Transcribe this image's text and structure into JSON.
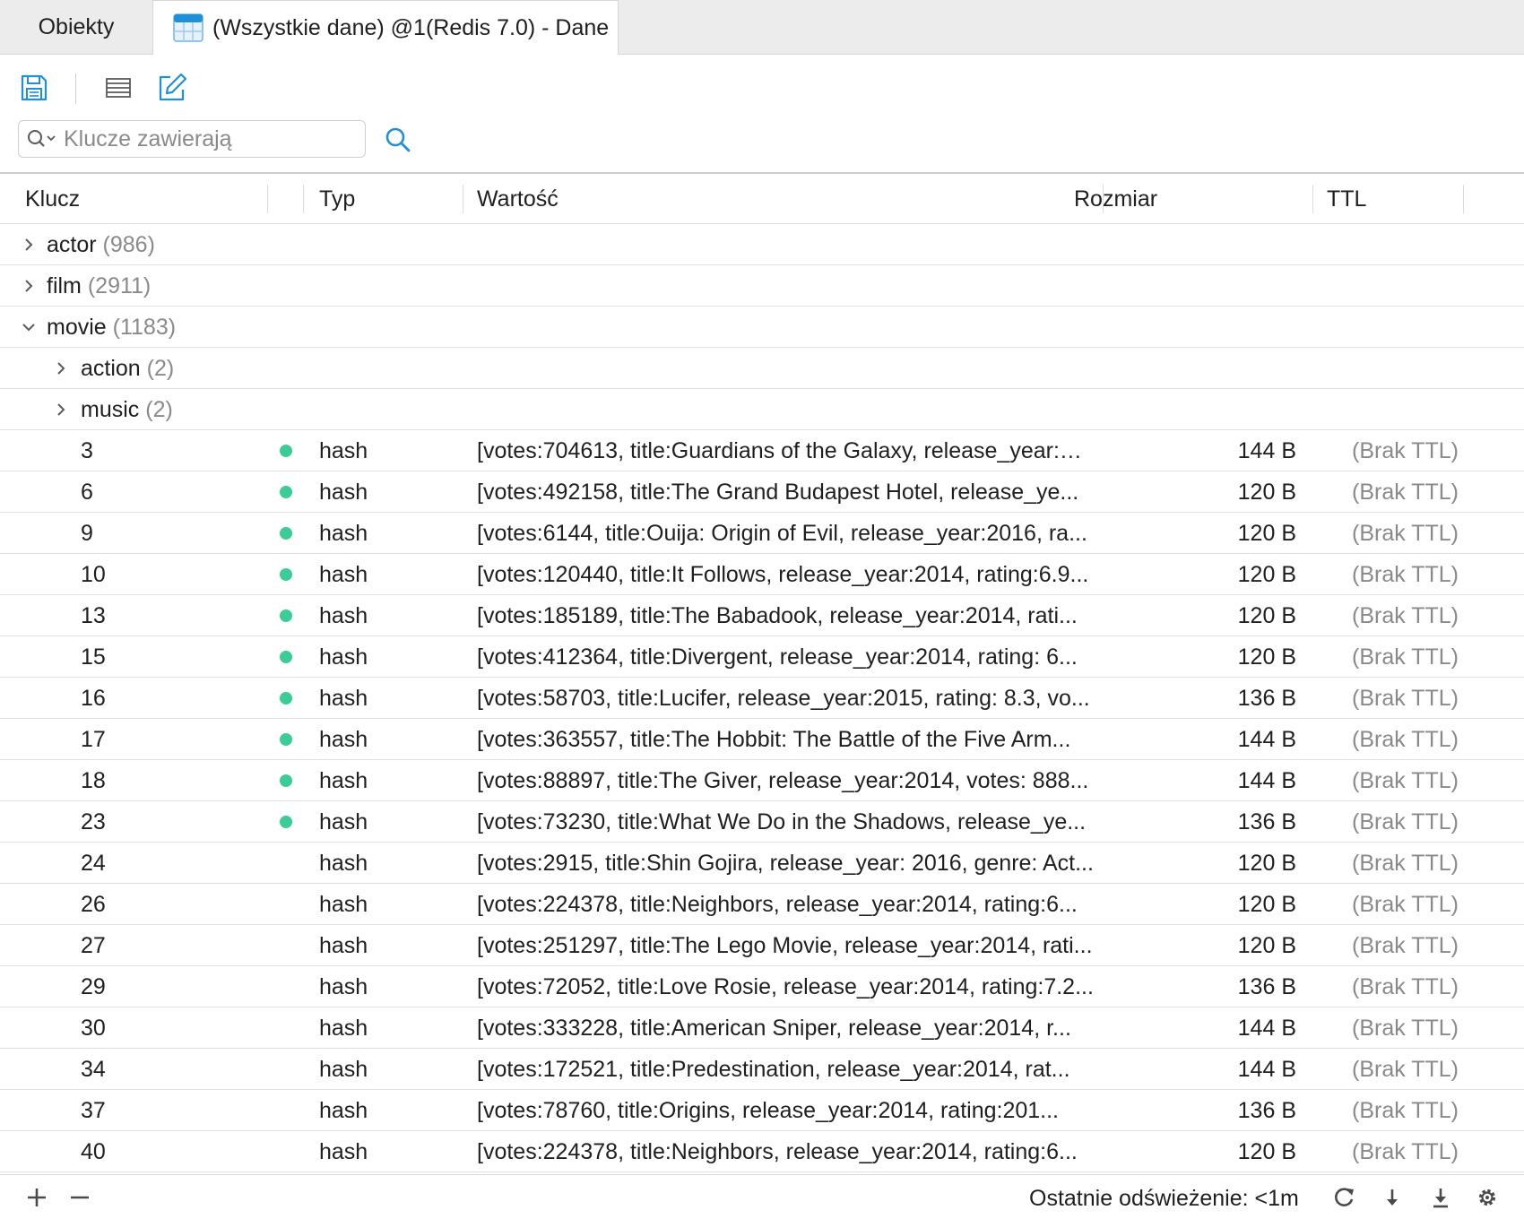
{
  "tabs": {
    "objects_label": "Obiekty",
    "active_label": "(Wszystkie dane) @1(Redis 7.0) - Dane"
  },
  "search": {
    "placeholder": "Klucze zawierają"
  },
  "columns": {
    "key": "Klucz",
    "type": "Typ",
    "value": "Wartość",
    "size": "Rozmiar",
    "ttl": "TTL"
  },
  "groups": [
    {
      "name": "actor",
      "count": "(986)",
      "expanded": false,
      "level": 0
    },
    {
      "name": "film",
      "count": "(2911)",
      "expanded": false,
      "level": 0
    },
    {
      "name": "movie",
      "count": "(1183)",
      "expanded": true,
      "level": 0
    },
    {
      "name": "action",
      "count": "(2)",
      "expanded": false,
      "level": 1
    },
    {
      "name": "music",
      "count": "(2)",
      "expanded": false,
      "level": 1
    }
  ],
  "records": [
    {
      "key": "3",
      "loaded": true,
      "type": "hash",
      "value": "[votes:704613, title:Guardians of the Galaxy, release_year:…",
      "size": "144 B",
      "ttl": "(Brak TTL)"
    },
    {
      "key": "6",
      "loaded": true,
      "type": "hash",
      "value": "[votes:492158, title:The Grand Budapest Hotel, release_ye...",
      "size": "120 B",
      "ttl": "(Brak TTL)"
    },
    {
      "key": "9",
      "loaded": true,
      "type": "hash",
      "value": "[votes:6144, title:Ouija: Origin of Evil, release_year:2016, ra...",
      "size": "120 B",
      "ttl": "(Brak TTL)"
    },
    {
      "key": "10",
      "loaded": true,
      "type": "hash",
      "value": "[votes:120440, title:It Follows, release_year:2014, rating:6.9...",
      "size": "120 B",
      "ttl": "(Brak TTL)"
    },
    {
      "key": "13",
      "loaded": true,
      "type": "hash",
      "value": "[votes:185189, title:The Babadook, release_year:2014, rati...",
      "size": "120 B",
      "ttl": "(Brak TTL)"
    },
    {
      "key": "15",
      "loaded": true,
      "type": "hash",
      "value": "[votes:412364, title:Divergent, release_year:2014, rating: 6...",
      "size": "120 B",
      "ttl": "(Brak TTL)"
    },
    {
      "key": "16",
      "loaded": true,
      "type": "hash",
      "value": "[votes:58703, title:Lucifer, release_year:2015, rating: 8.3, vo...",
      "size": "136 B",
      "ttl": "(Brak TTL)"
    },
    {
      "key": "17",
      "loaded": true,
      "type": "hash",
      "value": "[votes:363557, title:The Hobbit: The Battle of the Five Arm...",
      "size": "144 B",
      "ttl": "(Brak TTL)"
    },
    {
      "key": "18",
      "loaded": true,
      "type": "hash",
      "value": "[votes:88897, title:The Giver, release_year:2014, votes: 888...",
      "size": "144 B",
      "ttl": "(Brak TTL)"
    },
    {
      "key": "23",
      "loaded": true,
      "type": "hash",
      "value": "[votes:73230, title:What We Do in the Shadows, release_ye...",
      "size": "136 B",
      "ttl": "(Brak TTL)"
    },
    {
      "key": "24",
      "loaded": false,
      "type": "hash",
      "value": "[votes:2915, title:Shin Gojira, release_year: 2016, genre: Act...",
      "size": "120 B",
      "ttl": "(Brak TTL)"
    },
    {
      "key": "26",
      "loaded": false,
      "type": "hash",
      "value": "[votes:224378, title:Neighbors, release_year:2014, rating:6...",
      "size": "120 B",
      "ttl": "(Brak TTL)"
    },
    {
      "key": "27",
      "loaded": false,
      "type": "hash",
      "value": "[votes:251297, title:The Lego Movie, release_year:2014, rati...",
      "size": "120 B",
      "ttl": "(Brak TTL)"
    },
    {
      "key": "29",
      "loaded": false,
      "type": "hash",
      "value": "[votes:72052, title:Love Rosie, release_year:2014, rating:7.2...",
      "size": "136 B",
      "ttl": "(Brak TTL)"
    },
    {
      "key": "30",
      "loaded": false,
      "type": "hash",
      "value": "[votes:333228, title:American Sniper, release_year:2014, r...",
      "size": "144 B",
      "ttl": "(Brak TTL)"
    },
    {
      "key": "34",
      "loaded": false,
      "type": "hash",
      "value": "[votes:172521, title:Predestination, release_year:2014, rat...",
      "size": "144 B",
      "ttl": "(Brak TTL)"
    },
    {
      "key": "37",
      "loaded": false,
      "type": "hash",
      "value": "[votes:78760, title:Origins, release_year:2014, rating:201...",
      "size": "136 B",
      "ttl": "(Brak TTL)"
    },
    {
      "key": "40",
      "loaded": false,
      "type": "hash",
      "value": "[votes:224378, title:Neighbors, release_year:2014, rating:6...",
      "size": "120 B",
      "ttl": "(Brak TTL)"
    }
  ],
  "footer": {
    "status": "Ostatnie odświeżenie: <1m"
  },
  "colors": {
    "accent": "#1f8fd6",
    "loaded_dot": "#3ecc96"
  }
}
